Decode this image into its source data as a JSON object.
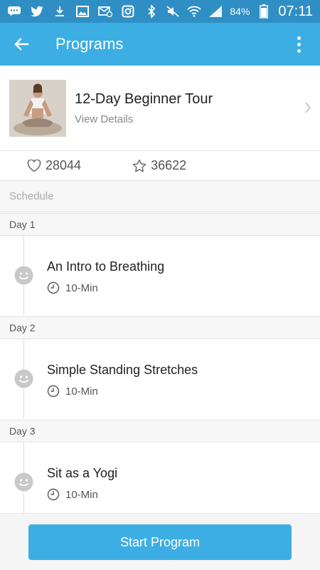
{
  "status_bar": {
    "battery_percent": "84%",
    "time": "07:11",
    "icons": [
      "chat-icon",
      "twitter-icon",
      "download-icon",
      "image-icon",
      "mail-icon",
      "instagram-icon",
      "bluetooth-icon",
      "mute-icon",
      "wifi-icon",
      "signal-icon",
      "battery-icon"
    ]
  },
  "app_bar": {
    "title": "Programs"
  },
  "program": {
    "title": "12-Day Beginner Tour",
    "subtitle": "View Details",
    "likes": "28044",
    "favorites": "36622"
  },
  "schedule": {
    "header": "Schedule",
    "days": [
      {
        "label": "Day 1",
        "session_title": "An Intro to Breathing",
        "duration": "10-Min"
      },
      {
        "label": "Day 2",
        "session_title": "Simple Standing Stretches",
        "duration": "10-Min"
      },
      {
        "label": "Day 3",
        "session_title": "Sit as a Yogi",
        "duration": "10-Min"
      }
    ]
  },
  "footer": {
    "start_label": "Start Program"
  },
  "colors": {
    "status_bar": "#2f8fc4",
    "accent": "#3caee3"
  }
}
